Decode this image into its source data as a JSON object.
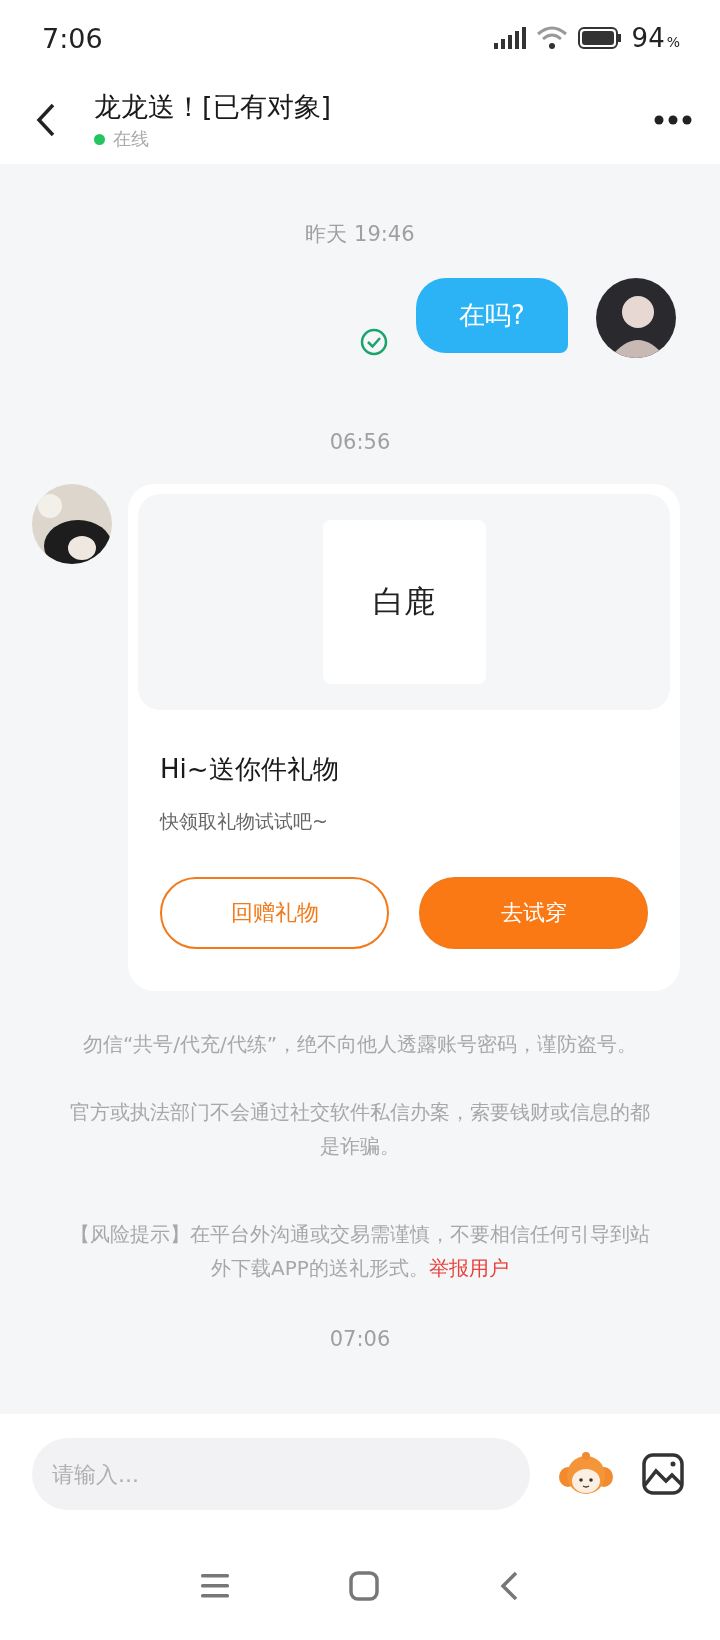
{
  "status_bar": {
    "time": "7:06",
    "battery": "94",
    "battery_unit": "%"
  },
  "header": {
    "title": "龙龙送！[已有对象]",
    "presence": "在线",
    "online": true
  },
  "messages": [
    {
      "kind": "time",
      "text": "昨天 19:46"
    },
    {
      "kind": "outgoing",
      "text": "在吗?",
      "read": true
    },
    {
      "kind": "time",
      "text": "06:56"
    },
    {
      "kind": "gift",
      "gift_name": "白鹿",
      "title": "Hi~送你件礼物",
      "subtitle": "快领取礼物试试吧~",
      "buttons": [
        {
          "label": "回赠礼物",
          "primary": false
        },
        {
          "label": "去试穿",
          "primary": true
        }
      ]
    },
    {
      "kind": "notice",
      "text": "勿信“共号/代充/代练”，绝不向他人透露账号密码，谨防盗号。"
    },
    {
      "kind": "notice",
      "text": "官方或执法部门不会通过社交软件私信办案，索要钱财或信息的都是诈骗。"
    },
    {
      "kind": "risk",
      "text": "【风险提示】在平台外沟通或交易需谨慎，不要相信任何引导到站外下载APP的送礼形式。",
      "link": "举报用户"
    },
    {
      "kind": "time",
      "text": "07:06"
    }
  ],
  "composer": {
    "placeholder": "请输入..."
  }
}
